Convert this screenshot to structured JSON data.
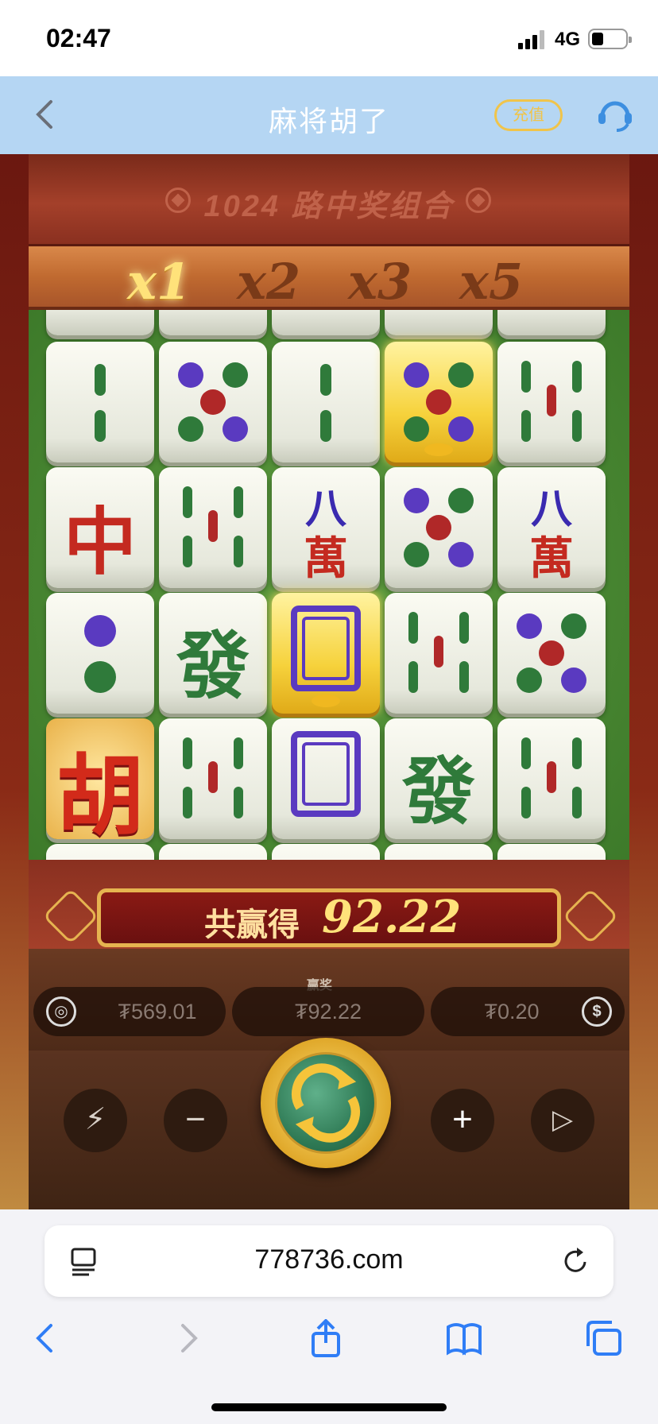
{
  "status_bar": {
    "time": "02:47",
    "network": "4G"
  },
  "header": {
    "title": "麻将胡了",
    "recharge_label": "充值"
  },
  "game": {
    "banner_title": "1024 路中奖组合",
    "multipliers": [
      "x1",
      "x2",
      "x3",
      "x5"
    ],
    "active_multiplier": "x1",
    "tiles": {
      "row1": [
        "tiao2",
        "tong5",
        "tiao2",
        "tong5-gold",
        "tiao5"
      ],
      "row2": [
        "zhong",
        "tiao5",
        "wan8",
        "tong5",
        "wan8"
      ],
      "row3": [
        "tong2",
        "fa",
        "bai-gold",
        "tiao5",
        "tong5"
      ],
      "row4": [
        "hu",
        "tiao5",
        "bai",
        "fa",
        "tiao5"
      ]
    },
    "glyphs": {
      "zhong": "中",
      "fa": "發",
      "wan_top": "八",
      "wan_bottom": "萬",
      "hu": "胡"
    },
    "win_label": "共赢得",
    "win_amount": "92.22",
    "balance": "₮569.01",
    "win_caption": "赢奖",
    "last_win": "₮92.22",
    "bet": "₮0.20",
    "controls": {
      "minus": "−",
      "plus": "+"
    }
  },
  "browser": {
    "url": "778736.com"
  }
}
